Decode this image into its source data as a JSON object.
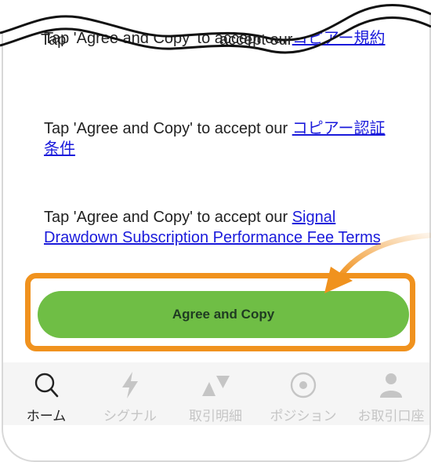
{
  "terms": [
    {
      "prefix": "Tap 'Agree and Copy' to accept our ",
      "link": "コピアー規約",
      "clipped_prefix": "Tap ",
      "clipped_middle": "accept our "
    },
    {
      "prefix": "Tap 'Agree and Copy' to accept our ",
      "link": "コピアー認証条件"
    },
    {
      "prefix": "Tap 'Agree and Copy' to accept our ",
      "link": "Signal Drawdown Subscription Performance Fee Terms"
    }
  ],
  "agree_button": {
    "label": "Agree and Copy"
  },
  "tabs": [
    {
      "label": "ホーム",
      "icon": "search-icon",
      "active": true
    },
    {
      "label": "シグナル",
      "icon": "lightning-icon",
      "active": false
    },
    {
      "label": "取引明細",
      "icon": "triangles-icon",
      "active": false
    },
    {
      "label": "ポジション",
      "icon": "target-icon",
      "active": false
    },
    {
      "label": "お取引口座",
      "icon": "person-icon",
      "active": false
    }
  ],
  "colors": {
    "accent_button": "#6fbe45",
    "highlight": "#f0921e",
    "link": "#1a1adb"
  }
}
